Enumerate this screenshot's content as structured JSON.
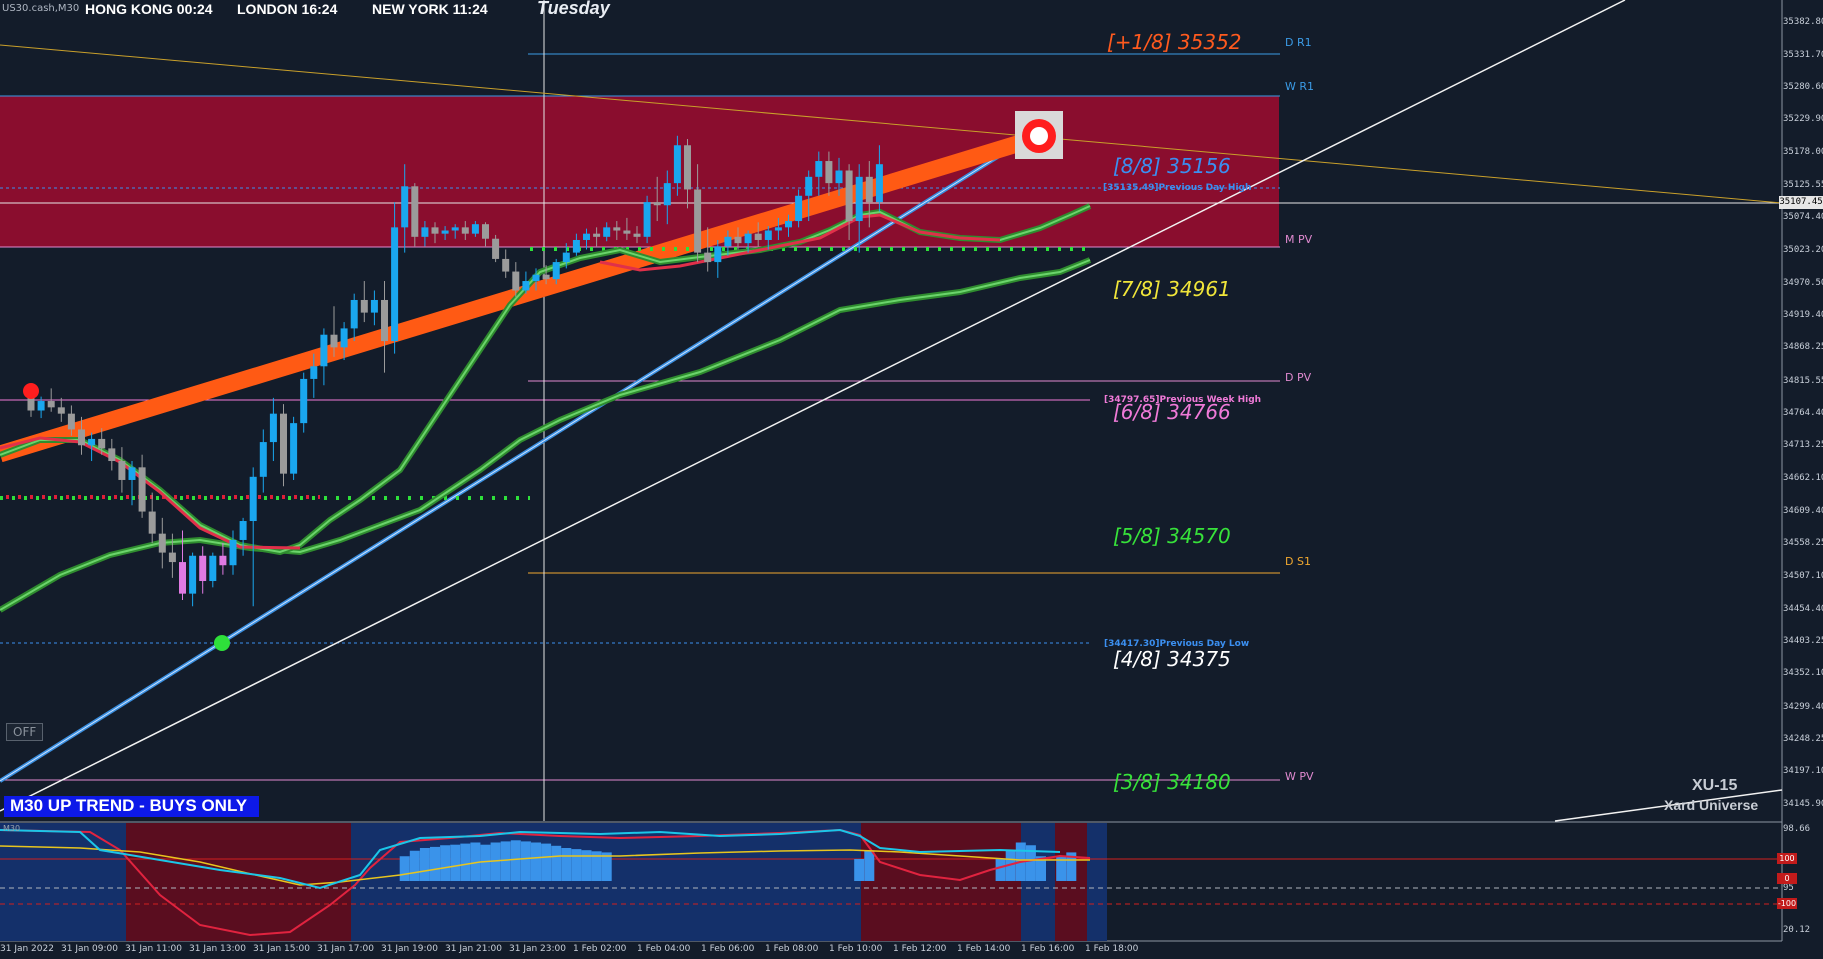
{
  "header": {
    "symbol": "US30.cash,M30",
    "sessions": [
      {
        "label": "HONG KONG 00:24",
        "color": "#b3242b"
      },
      {
        "label": "LONDON  16:24",
        "color": "#1e6fc2"
      },
      {
        "label": "NEW YORK  11:24",
        "color": "#1e6fc2"
      }
    ],
    "day": "Tuesday"
  },
  "murrey_levels": [
    {
      "label": "[+1/8] 35352",
      "price": 35352,
      "color": "#ff5a1e"
    },
    {
      "label": "[8/8] 35156",
      "price": 35156,
      "color": "#3b8ff0"
    },
    {
      "label": "[7/8] 34961",
      "price": 34961,
      "color": "#f1e63a"
    },
    {
      "label": "[6/8] 34766",
      "price": 34766,
      "color": "#f07ad8"
    },
    {
      "label": "[5/8] 34570",
      "price": 34570,
      "color": "#37e23a"
    },
    {
      "label": "[4/8] 34375",
      "price": 34375,
      "color": "#ffffff"
    },
    {
      "label": "[3/8] 34180",
      "price": 34180,
      "color": "#37e23a"
    }
  ],
  "pivot_labels": [
    {
      "label": "D R1",
      "price": 35352,
      "color": "#3b9be6"
    },
    {
      "label": "W R1",
      "price": 35282,
      "color": "#3b9be6"
    },
    {
      "label": "M PV",
      "price": 35040,
      "color": "#e08ad0"
    },
    {
      "label": "D PV",
      "price": 34822,
      "color": "#e08ad0"
    },
    {
      "label": "D S1",
      "price": 34530,
      "color": "#f0a830"
    },
    {
      "label": "W PV",
      "price": 34190,
      "color": "#e08ad0"
    }
  ],
  "annotations": {
    "prev_week_high": "[34797.65]Previous Week High",
    "prev_day_high": "[35135.49]Previous Day High",
    "prev_day_low": "[34417.30]Previous Day Low"
  },
  "price_axis": [
    "35382.80",
    "35331.70",
    "35280.60",
    "35229.90",
    "35178.00",
    "35125.55",
    "35074.40",
    "35023.20",
    "34970.50",
    "34919.40",
    "34868.25",
    "34815.55",
    "34764.40",
    "34713.25",
    "34662.10",
    "34609.40",
    "34558.25",
    "34507.10",
    "34454.40",
    "34403.25",
    "34352.10",
    "34299.40",
    "34248.25",
    "34197.10",
    "34145.90"
  ],
  "current_price": "35107.45",
  "time_axis": [
    "31 Jan 2022",
    "31 Jan 09:00",
    "31 Jan 11:00",
    "31 Jan 13:00",
    "31 Jan 15:00",
    "31 Jan 17:00",
    "31 Jan 19:00",
    "31 Jan 21:00",
    "31 Jan 23:00",
    "1 Feb 02:00",
    "1 Feb 04:00",
    "1 Feb 06:00",
    "1 Feb 08:00",
    "1 Feb 10:00",
    "1 Feb 12:00",
    "1 Feb 14:00",
    "1 Feb 16:00",
    "1 Feb 18:00"
  ],
  "trend_banner": "M30 UP TREND - BUYS ONLY",
  "off_button": "OFF",
  "brand": {
    "line1": "XU-15",
    "line2": "Xard Universe"
  },
  "indicator": {
    "label": "M30",
    "axis": [
      "98.66",
      "95",
      "20.12"
    ],
    "level_boxes": [
      "100",
      "0",
      "-100"
    ]
  },
  "candles": [
    [
      34790,
      34802,
      34760,
      34770
    ],
    [
      34770,
      34792,
      34758,
      34785
    ],
    [
      34785,
      34805,
      34768,
      34775
    ],
    [
      34775,
      34790,
      34752,
      34765
    ],
    [
      34765,
      34778,
      34730,
      34740
    ],
    [
      34740,
      34760,
      34700,
      34715
    ],
    [
      34715,
      34735,
      34690,
      34725
    ],
    [
      34725,
      34742,
      34700,
      34710
    ],
    [
      34710,
      34725,
      34675,
      34690
    ],
    [
      34690,
      34712,
      34640,
      34660
    ],
    [
      34660,
      34690,
      34620,
      34680
    ],
    [
      34680,
      34700,
      34600,
      34610
    ],
    [
      34610,
      34640,
      34560,
      34575
    ],
    [
      34575,
      34600,
      34520,
      34545
    ],
    [
      34545,
      34575,
      34505,
      34530
    ],
    [
      34530,
      34580,
      34470,
      34480
    ],
    [
      34480,
      34545,
      34460,
      34540
    ],
    [
      34540,
      34555,
      34480,
      34500
    ],
    [
      34500,
      34545,
      34490,
      34540
    ],
    [
      34540,
      34560,
      34510,
      34525
    ],
    [
      34525,
      34580,
      34510,
      34565
    ],
    [
      34565,
      34600,
      34540,
      34595
    ],
    [
      34595,
      34680,
      34460,
      34665
    ],
    [
      34665,
      34740,
      34640,
      34720
    ],
    [
      34720,
      34790,
      34690,
      34765
    ],
    [
      34765,
      34780,
      34650,
      34670
    ],
    [
      34670,
      34760,
      34660,
      34750
    ],
    [
      34750,
      34830,
      34735,
      34820
    ],
    [
      34820,
      34860,
      34790,
      34840
    ],
    [
      34840,
      34900,
      34810,
      34890
    ],
    [
      34890,
      34935,
      34855,
      34870
    ],
    [
      34870,
      34910,
      34850,
      34900
    ],
    [
      34900,
      34955,
      34880,
      34945
    ],
    [
      34945,
      34975,
      34910,
      34925
    ],
    [
      34925,
      34960,
      34905,
      34945
    ],
    [
      34945,
      34975,
      34830,
      34880
    ],
    [
      34880,
      35100,
      34860,
      35060
    ],
    [
      35060,
      35160,
      35020,
      35125
    ],
    [
      35125,
      35130,
      35030,
      35045
    ],
    [
      35045,
      35070,
      35030,
      35060
    ],
    [
      35060,
      35068,
      35035,
      35050
    ],
    [
      35050,
      35062,
      35040,
      35055
    ],
    [
      35055,
      35065,
      35042,
      35060
    ],
    [
      35060,
      35070,
      35040,
      35050
    ],
    [
      35050,
      35070,
      35045,
      35065
    ],
    [
      35065,
      35068,
      35030,
      35042
    ],
    [
      35042,
      35048,
      35005,
      35010
    ],
    [
      35010,
      35025,
      34980,
      34990
    ],
    [
      34990,
      35005,
      34950,
      34960
    ],
    [
      34960,
      34990,
      34955,
      34975
    ],
    [
      34975,
      34995,
      34960,
      34985
    ],
    [
      34985,
      35000,
      34970,
      34978
    ],
    [
      34978,
      35010,
      34970,
      35005
    ],
    [
      35005,
      35035,
      34995,
      35020
    ],
    [
      35020,
      35050,
      35015,
      35040
    ],
    [
      35040,
      35058,
      35025,
      35050
    ],
    [
      35050,
      35060,
      35030,
      35045
    ],
    [
      35045,
      35068,
      35038,
      35060
    ],
    [
      35060,
      35070,
      35040,
      35055
    ],
    [
      35055,
      35075,
      35040,
      35050
    ],
    [
      35050,
      35062,
      35035,
      35045
    ],
    [
      35045,
      35110,
      35035,
      35100
    ],
    [
      35100,
      35140,
      35070,
      35095
    ],
    [
      35095,
      35150,
      35065,
      35130
    ],
    [
      35130,
      35205,
      35110,
      35190
    ],
    [
      35190,
      35200,
      35090,
      35120
    ],
    [
      35120,
      35160,
      35005,
      35020
    ],
    [
      35020,
      35060,
      34990,
      35005
    ],
    [
      35005,
      35040,
      34980,
      35030
    ],
    [
      35030,
      35055,
      35015,
      35045
    ],
    [
      35045,
      35060,
      35025,
      35035
    ],
    [
      35035,
      35055,
      35020,
      35050
    ],
    [
      35050,
      35068,
      35030,
      35040
    ],
    [
      35040,
      35062,
      35025,
      35055
    ],
    [
      35055,
      35075,
      35040,
      35060
    ],
    [
      35060,
      35080,
      35045,
      35070
    ],
    [
      35070,
      35120,
      35060,
      35110
    ],
    [
      35110,
      35150,
      35070,
      35140
    ],
    [
      35140,
      35180,
      35110,
      35165
    ],
    [
      35165,
      35180,
      35110,
      35130
    ],
    [
      35130,
      35170,
      35110,
      35150
    ],
    [
      35150,
      35160,
      35040,
      35070
    ],
    [
      35070,
      35160,
      35020,
      35140
    ],
    [
      35140,
      35165,
      35060,
      35100
    ],
    [
      35100,
      35190,
      35085,
      35160
    ]
  ],
  "histogram": [
    {
      "i": 37,
      "v": 0.45
    },
    {
      "i": 38,
      "v": 0.55
    },
    {
      "i": 39,
      "v": 0.6
    },
    {
      "i": 40,
      "v": 0.62
    },
    {
      "i": 41,
      "v": 0.65
    },
    {
      "i": 42,
      "v": 0.66
    },
    {
      "i": 43,
      "v": 0.68
    },
    {
      "i": 44,
      "v": 0.7
    },
    {
      "i": 45,
      "v": 0.66
    },
    {
      "i": 46,
      "v": 0.7
    },
    {
      "i": 47,
      "v": 0.72
    },
    {
      "i": 48,
      "v": 0.74
    },
    {
      "i": 49,
      "v": 0.72
    },
    {
      "i": 50,
      "v": 0.7
    },
    {
      "i": 51,
      "v": 0.68
    },
    {
      "i": 52,
      "v": 0.64
    },
    {
      "i": 53,
      "v": 0.6
    },
    {
      "i": 54,
      "v": 0.58
    },
    {
      "i": 55,
      "v": 0.56
    },
    {
      "i": 56,
      "v": 0.54
    },
    {
      "i": 57,
      "v": 0.52
    },
    {
      "i": 82,
      "v": 0.4
    },
    {
      "i": 83,
      "v": 0.55
    },
    {
      "i": 96,
      "v": 0.4
    },
    {
      "i": 97,
      "v": 0.55
    },
    {
      "i": 98,
      "v": 0.7
    },
    {
      "i": 99,
      "v": 0.65
    },
    {
      "i": 100,
      "v": 0.45
    },
    {
      "i": 102,
      "v": 0.45
    },
    {
      "i": 103,
      "v": 0.52
    }
  ]
}
